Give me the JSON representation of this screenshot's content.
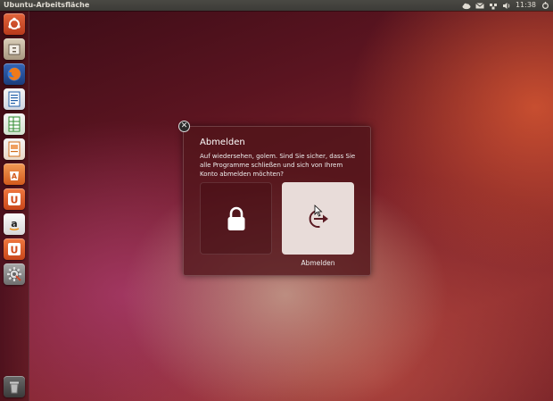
{
  "panel": {
    "title": "Ubuntu-Arbeitsfläche",
    "clock": "11:38",
    "tray_icons": [
      "cloud-icon",
      "mail-icon",
      "network-icon",
      "volume-icon",
      "gear-icon"
    ]
  },
  "launcher": {
    "items": [
      {
        "name": "dash-home",
        "icon": "ubuntu-logo-icon",
        "color": "#c8472a"
      },
      {
        "name": "files",
        "icon": "file-cabinet-icon",
        "color": "#c9b9a0"
      },
      {
        "name": "firefox",
        "icon": "firefox-icon",
        "color": "#e66000"
      },
      {
        "name": "libreoffice-writer",
        "icon": "document-icon",
        "color": "#1f5ea8"
      },
      {
        "name": "libreoffice-calc",
        "icon": "spreadsheet-icon",
        "color": "#2c8a2c"
      },
      {
        "name": "libreoffice-impress",
        "icon": "presentation-icon",
        "color": "#d06c1a"
      },
      {
        "name": "software-center",
        "icon": "shopping-bag-icon",
        "color": "#e8702a"
      },
      {
        "name": "ubuntu-one",
        "icon": "ubuntu-one-icon",
        "color": "#e05a1e"
      },
      {
        "name": "amazon",
        "icon": "amazon-icon",
        "color": "#f0f0f0"
      },
      {
        "name": "ubuntu-one-music",
        "icon": "ubuntu-one-icon",
        "color": "#e05a1e"
      },
      {
        "name": "system-settings",
        "icon": "settings-gear-icon",
        "color": "#8a8a8a"
      },
      {
        "name": "trash",
        "icon": "trash-icon",
        "color": "#9a9a9a"
      }
    ]
  },
  "dialog": {
    "title": "Abmelden",
    "message": "Auf wiedersehen, golem. Sind Sie sicher, dass Sie alle Programme schließen und sich von Ihrem Konto abmelden möchten?",
    "logout_label": "Abmelden",
    "lock_icon": "lock-icon",
    "logout_icon": "logout-icon"
  },
  "colors": {
    "panel_bg": "#3c3b37",
    "dialog_bg": "#501419",
    "selected_button_bg": "#e8dcd9",
    "logout_icon_color": "#5a1a22"
  }
}
